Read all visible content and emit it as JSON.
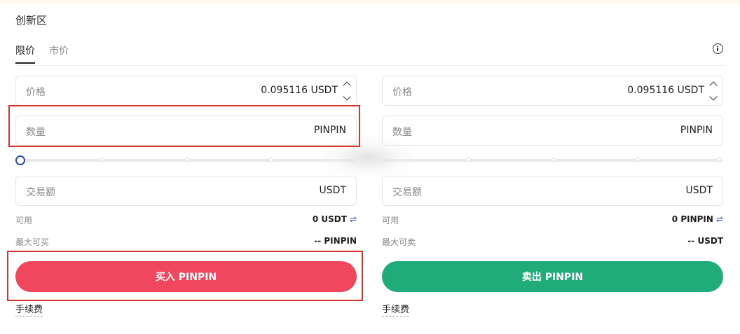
{
  "zone_title": "创新区",
  "tabs": [
    {
      "label": "限价",
      "active": true
    },
    {
      "label": "市价",
      "active": false
    }
  ],
  "buy": {
    "price_label": "价格",
    "price_value": "0.095116 USDT",
    "quantity_label": "数量",
    "quantity_unit": "PINPIN",
    "amount_label": "交易额",
    "amount_unit": "USDT",
    "available_label": "可用",
    "available_value": "0 USDT",
    "max_label": "最大可买",
    "max_value": "-- PINPIN",
    "action_label": "买入 PINPIN",
    "fee_label": "手续费"
  },
  "sell": {
    "price_label": "价格",
    "price_value": "0.095116 USDT",
    "quantity_label": "数量",
    "quantity_unit": "PINPIN",
    "amount_label": "交易额",
    "amount_unit": "USDT",
    "available_label": "可用",
    "available_value": "0 PINPIN",
    "max_label": "最大可卖",
    "max_value": "-- USDT",
    "action_label": "卖出 PINPIN",
    "fee_label": "手续费"
  },
  "slider_percent": 0,
  "colors": {
    "buy": "#f0475e",
    "sell": "#1fac7a",
    "accent": "#2d4ea1",
    "highlight": "#d9352f"
  },
  "icons": {
    "info": "info-circle-icon",
    "swap": "swap-arrows-icon",
    "stepper_up": "chevron-up-icon",
    "stepper_down": "chevron-down-icon"
  }
}
